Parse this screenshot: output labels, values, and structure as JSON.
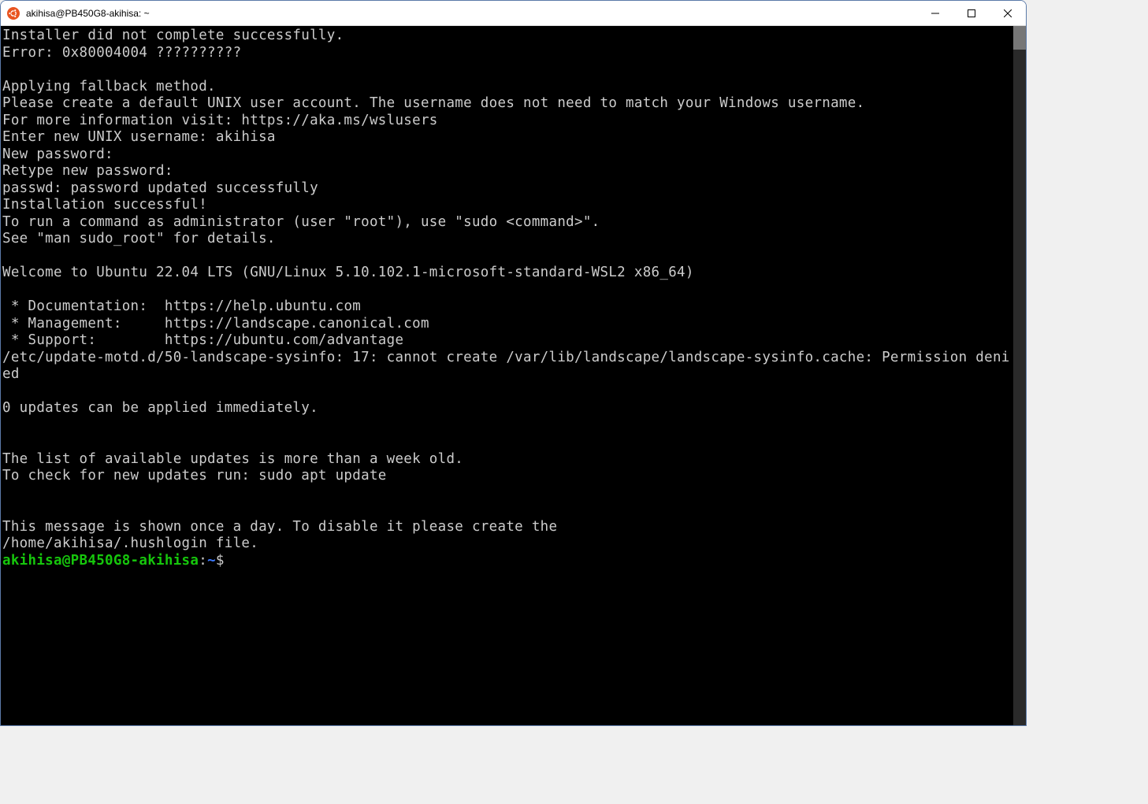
{
  "window": {
    "title": "akihisa@PB450G8-akihisa: ~"
  },
  "terminal": {
    "lines": [
      "Installer did not complete successfully.",
      "Error: 0x80004004 ??????????",
      "",
      "Applying fallback method.",
      "Please create a default UNIX user account. The username does not need to match your Windows username.",
      "For more information visit: https://aka.ms/wslusers",
      "Enter new UNIX username: akihisa",
      "New password:",
      "Retype new password:",
      "passwd: password updated successfully",
      "Installation successful!",
      "To run a command as administrator (user \"root\"), use \"sudo <command>\".",
      "See \"man sudo_root\" for details.",
      "",
      "Welcome to Ubuntu 22.04 LTS (GNU/Linux 5.10.102.1-microsoft-standard-WSL2 x86_64)",
      "",
      " * Documentation:  https://help.ubuntu.com",
      " * Management:     https://landscape.canonical.com",
      " * Support:        https://ubuntu.com/advantage",
      "/etc/update-motd.d/50-landscape-sysinfo: 17: cannot create /var/lib/landscape/landscape-sysinfo.cache: Permission denied",
      "",
      "0 updates can be applied immediately.",
      "",
      "",
      "The list of available updates is more than a week old.",
      "To check for new updates run: sudo apt update",
      "",
      "",
      "This message is shown once a day. To disable it please create the",
      "/home/akihisa/.hushlogin file."
    ],
    "prompt": {
      "user_host": "akihisa@PB450G8-akihisa",
      "colon": ":",
      "path": "~",
      "dollar": "$"
    }
  }
}
